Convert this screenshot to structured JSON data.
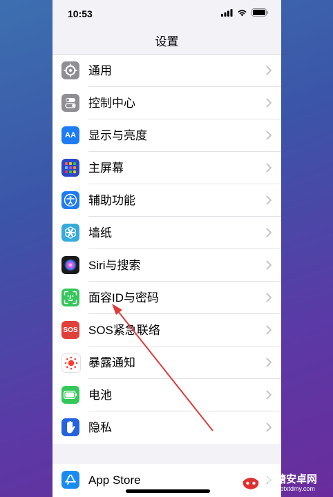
{
  "status_bar": {
    "time": "10:53"
  },
  "nav": {
    "title": "设置"
  },
  "settings": [
    {
      "label": "通用",
      "icon": "gear-icon",
      "color": "#8e8e93"
    },
    {
      "label": "控制中心",
      "icon": "toggles-icon",
      "color": "#8e8e93"
    },
    {
      "label": "显示与亮度",
      "icon": "text-size-icon",
      "color": "#1e7cf2",
      "glyph": "AA"
    },
    {
      "label": "主屏幕",
      "icon": "app-grid-icon",
      "color": "#2c48c8"
    },
    {
      "label": "辅助功能",
      "icon": "accessibility-icon",
      "color": "#1e7cf2"
    },
    {
      "label": "墙纸",
      "icon": "flower-icon",
      "color": "#35aadc"
    },
    {
      "label": "Siri与搜索",
      "icon": "siri-icon",
      "color": "#1a1a1a"
    },
    {
      "label": "面容ID与密码",
      "icon": "face-id-icon",
      "color": "#34c759"
    },
    {
      "label": "SOS紧急联络",
      "icon": "sos-icon",
      "color": "#e0403a",
      "glyph": "SOS"
    },
    {
      "label": "暴露通知",
      "icon": "exposure-icon",
      "color": "#ffffff"
    },
    {
      "label": "电池",
      "icon": "battery-icon",
      "color": "#34c759"
    },
    {
      "label": "隐私",
      "icon": "hand-icon",
      "color": "#2463e0"
    }
  ],
  "store": {
    "label": "App Store",
    "icon": "app-store-icon",
    "color": "#1a8cf0"
  },
  "annotation": {
    "color": "#e03a3a"
  },
  "watermark": {
    "title": "冰糖安卓网",
    "url": "www.btxtdmy.com"
  }
}
